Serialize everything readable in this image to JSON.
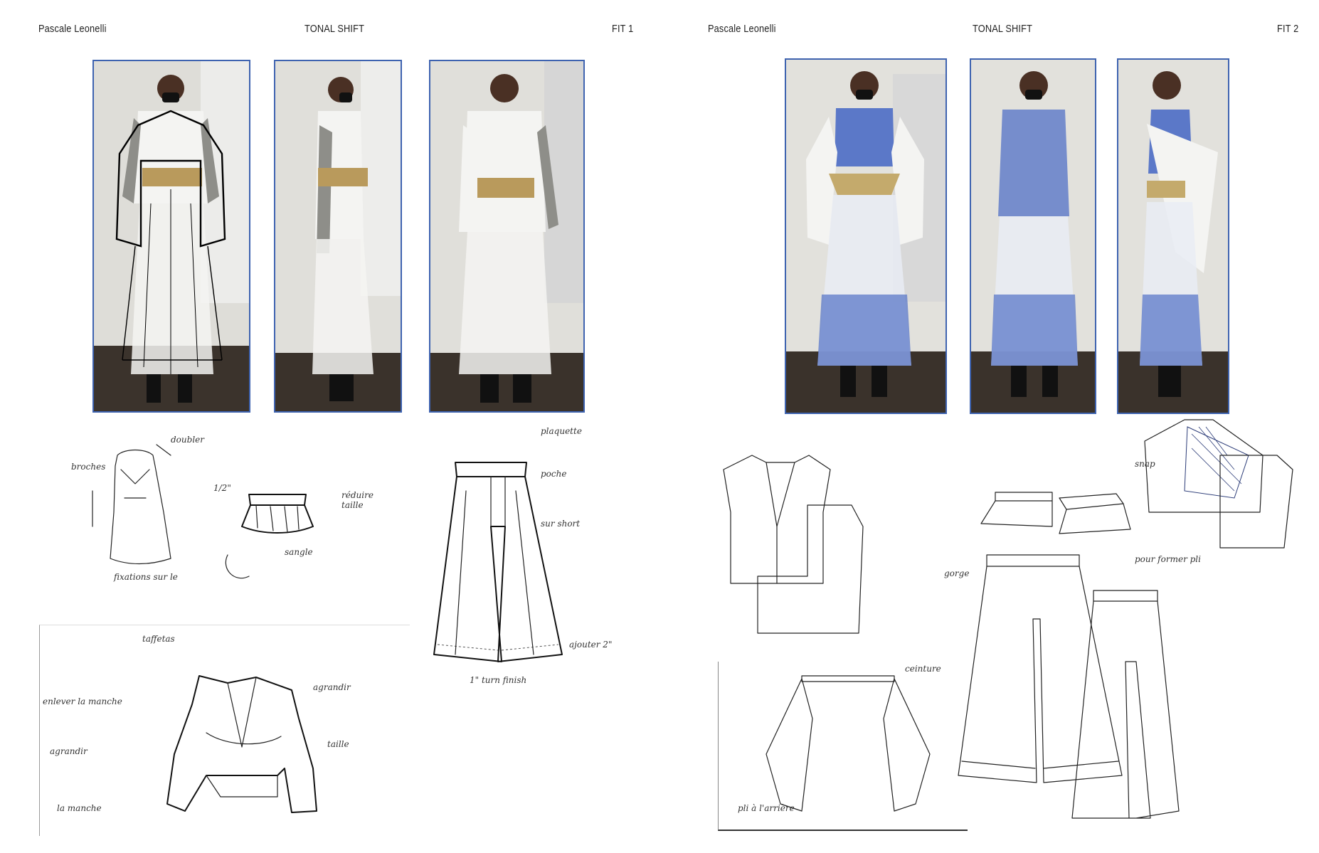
{
  "left_page": {
    "designer": "Pascale Leonelli",
    "collection": "TONAL SHIFT",
    "fit_label": "FIT 1",
    "photos": [
      "front-view",
      "side-view",
      "back-view"
    ]
  },
  "right_page": {
    "designer": "Pascale Leonelli",
    "collection": "TONAL SHIFT",
    "fit_label": "FIT 2",
    "photos": [
      "front-view",
      "front-view-open",
      "side-view"
    ]
  },
  "colors": {
    "photo_border": "#3e63b0",
    "wall": "#dedcd6",
    "floor": "#332c26",
    "organza_blue": "#5b78c8",
    "cork_belt": "#b99a5c",
    "white_fabric": "#f6f6f4",
    "grey_sleeve": "#8d8d88",
    "note_marker": "#4cb84c"
  }
}
